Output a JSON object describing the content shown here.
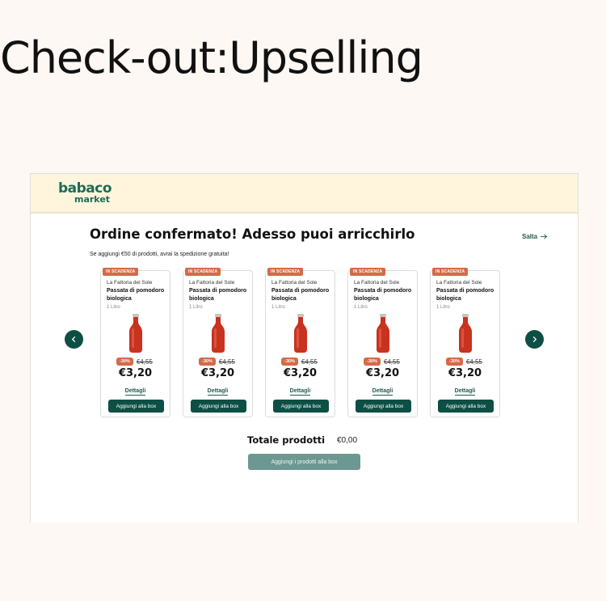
{
  "heading": "Check-out:Upselling",
  "logo": {
    "line1": "babaco",
    "line2": "market"
  },
  "order": {
    "title": "Ordine confermato! Adesso puoi arricchirlo",
    "subtitle": "Se aggiungi €50 di prodotti, avrai la spedizione gratuita!",
    "skip_label": "Salta"
  },
  "products": [
    {
      "badge": "IN SCADENZA",
      "brand": "La Fattoria del Sole",
      "name": "Passata di pomodoro biologica",
      "quantity": "1 Litro",
      "discount": "-30%",
      "old_price": "€4,55",
      "price": "€3,20",
      "details_label": "Dettagli",
      "add_label": "Aggiungi alla box"
    },
    {
      "badge": "IN SCADENZA",
      "brand": "La Fattoria del Sole",
      "name": "Passata di pomodoro biologica",
      "quantity": "1 Litro",
      "discount": "-30%",
      "old_price": "€4,55",
      "price": "€3,20",
      "details_label": "Dettagli",
      "add_label": "Aggiungi alla box"
    },
    {
      "badge": "IN SCADENZA",
      "brand": "La Fattoria del Sole",
      "name": "Passata di pomodoro biologica",
      "quantity": "1 Litro",
      "discount": "-30%",
      "old_price": "€4,55",
      "price": "€3,20",
      "details_label": "Dettagli",
      "add_label": "Aggiungi alla box"
    },
    {
      "badge": "IN SCADENZA",
      "brand": "La Fattoria del Sole",
      "name": "Passata di pomodoro biologica",
      "quantity": "1 Litro",
      "discount": "-30%",
      "old_price": "€4,55",
      "price": "€3,20",
      "details_label": "Dettagli",
      "add_label": "Aggiungi alla box"
    },
    {
      "badge": "IN SCADENZA",
      "brand": "La Fattoria del Sole",
      "name": "Passata di pomodoro biologica",
      "quantity": "1 Litro",
      "discount": "-30%",
      "old_price": "€4,55",
      "price": "€3,20",
      "details_label": "Dettagli",
      "add_label": "Aggiungi alla box"
    }
  ],
  "carousel": {
    "prev_icon": "chevron-left-icon",
    "next_icon": "chevron-right-icon"
  },
  "totals": {
    "label": "Totale prodotti",
    "value": "€0,00",
    "button_label": "Aggiungi i prodotti alla box"
  },
  "colors": {
    "brand_green": "#0d4f45",
    "badge_orange": "#d56a48",
    "header_cream": "#fef5dc",
    "disabled_button": "#6c9891"
  }
}
